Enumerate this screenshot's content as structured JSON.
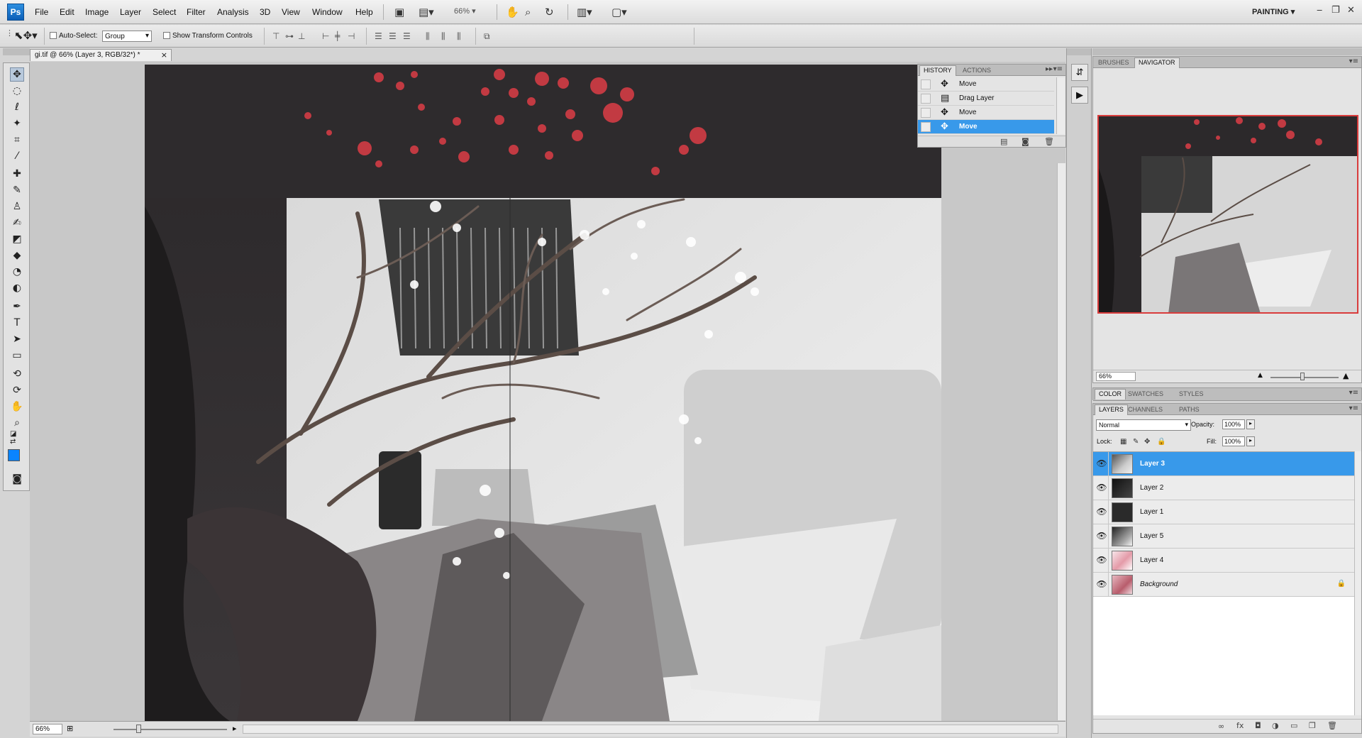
{
  "app": {
    "logo": "Ps",
    "workspace": "PAINTING",
    "zoom_percent": "66%"
  },
  "menu": [
    "File",
    "Edit",
    "Image",
    "Layer",
    "Select",
    "Filter",
    "Analysis",
    "3D",
    "View",
    "Window",
    "Help"
  ],
  "window_controls": {
    "minimize": "‒",
    "restore": "❐",
    "close": "✕"
  },
  "options_bar": {
    "auto_select_label": "Auto-Select:",
    "auto_select_value": "Group",
    "show_transform_label": "Show Transform Controls"
  },
  "document": {
    "tab_title": "gi.tif @ 66% (Layer 3, RGB/32*) *",
    "close": "×",
    "status_zoom": "66%"
  },
  "colors": {
    "foreground": "#0a84ff",
    "background": "#ffffff",
    "selection": "#3899ea",
    "nav_frame": "#d93c3c"
  },
  "history": {
    "tabs": [
      "HISTORY",
      "ACTIONS"
    ],
    "items": [
      {
        "label": "Move",
        "icon": "move-tool-icon",
        "selected": false
      },
      {
        "label": "Drag Layer",
        "icon": "drag-layer-icon",
        "selected": false
      },
      {
        "label": "Move",
        "icon": "move-tool-icon",
        "selected": false
      },
      {
        "label": "Move",
        "icon": "move-tool-icon",
        "selected": true
      }
    ]
  },
  "navigator": {
    "tabs": [
      "BRUSHES",
      "NAVIGATOR"
    ],
    "zoom": "66%"
  },
  "color_panel": {
    "tabs": [
      "COLOR",
      "SWATCHES",
      "STYLES"
    ]
  },
  "layers": {
    "tabs": [
      "LAYERS",
      "CHANNELS",
      "PATHS"
    ],
    "blend_mode": "Normal",
    "opacity_label": "Opacity:",
    "opacity": "100%",
    "lock_label": "Lock:",
    "fill_label": "Fill:",
    "fill": "100%",
    "items": [
      {
        "name": "Layer 3",
        "selected": true,
        "locked": false
      },
      {
        "name": "Layer 2",
        "selected": false,
        "locked": false
      },
      {
        "name": "Layer 1",
        "selected": false,
        "locked": false
      },
      {
        "name": "Layer 5",
        "selected": false,
        "locked": false
      },
      {
        "name": "Layer 4",
        "selected": false,
        "locked": false
      },
      {
        "name": "Background",
        "selected": false,
        "locked": true
      }
    ]
  }
}
